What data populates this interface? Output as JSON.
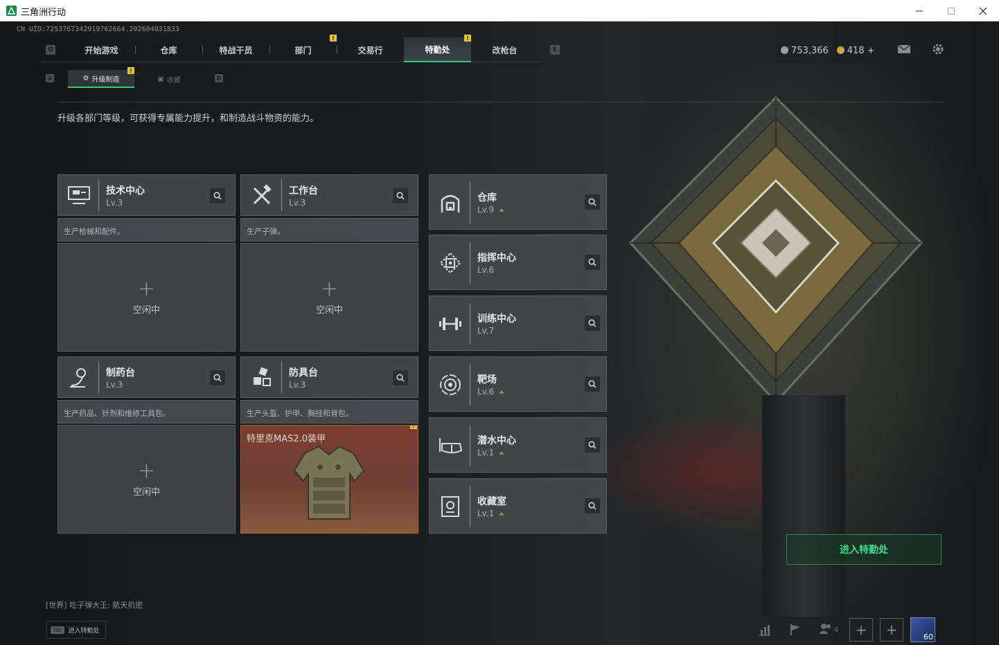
{
  "window": {
    "title": "三角洲行动",
    "controls": [
      "minimize",
      "maximize",
      "close"
    ]
  },
  "uid": "CN UID:7253767342919762664.202604031833",
  "nav": {
    "left_key": "Q",
    "right_key": "E",
    "tabs": [
      "开始游戏",
      "仓库",
      "特战干员",
      "部门",
      "交易行",
      "特勤处",
      "改枪台"
    ],
    "active": "特勤处",
    "badges": [
      "!",
      "!"
    ]
  },
  "currency": {
    "silver": "753,366",
    "gold": "418 +"
  },
  "subtabs": {
    "left_key": "A",
    "right_key": "D",
    "items": [
      "升级制造",
      "收藏"
    ],
    "active": "升级制造",
    "badge": "!"
  },
  "description": "升级各部门等级，可获得专属能力提升，和制造战斗物资的能力。",
  "stations": [
    {
      "name": "技术中心",
      "level": "Lv.3",
      "desc": "生产枪械和配件。",
      "status": "空闲中",
      "icon": "monitor-icon"
    },
    {
      "name": "工作台",
      "level": "Lv.3",
      "desc": "生产子弹。",
      "status": "空闲中",
      "icon": "tools-icon"
    },
    {
      "name": "制药台",
      "level": "Lv.3",
      "desc": "生产药品、针剂和维修工具包。",
      "status": "空闲中",
      "icon": "microscope-icon"
    },
    {
      "name": "防具台",
      "level": "Lv.3",
      "desc": "生产头盔、护甲、胸挂和背包。",
      "status": "特里克MAS2.0装甲",
      "icon": "blocks-icon"
    }
  ],
  "facilities": [
    {
      "name": "仓库",
      "level": "Lv.9",
      "upgradable": true,
      "icon": "vault-icon"
    },
    {
      "name": "指挥中心",
      "level": "Lv.6",
      "upgradable": false,
      "icon": "chip-icon"
    },
    {
      "name": "训练中心",
      "level": "Lv.7",
      "upgradable": false,
      "icon": "dumbbell-icon"
    },
    {
      "name": "靶场",
      "level": "Lv.6",
      "upgradable": true,
      "icon": "target-icon"
    },
    {
      "name": "潜水中心",
      "level": "Lv.1",
      "upgradable": true,
      "icon": "goggles-icon"
    },
    {
      "name": "收藏室",
      "level": "Lv.1",
      "upgradable": true,
      "icon": "trophy-icon"
    }
  ],
  "enter_button": "进入特勤处",
  "chat": "[世界] 吃子弹大王: 航天机密",
  "tab_hint": {
    "key": "Tab",
    "label": "进入特勤处"
  },
  "bottom": {
    "friends_count": "4",
    "avatar_level": "60"
  },
  "colors": {
    "accent_green": "#2ecc71",
    "badge_yellow": "#e6c13a",
    "armor_bg": "#7a3d33"
  }
}
